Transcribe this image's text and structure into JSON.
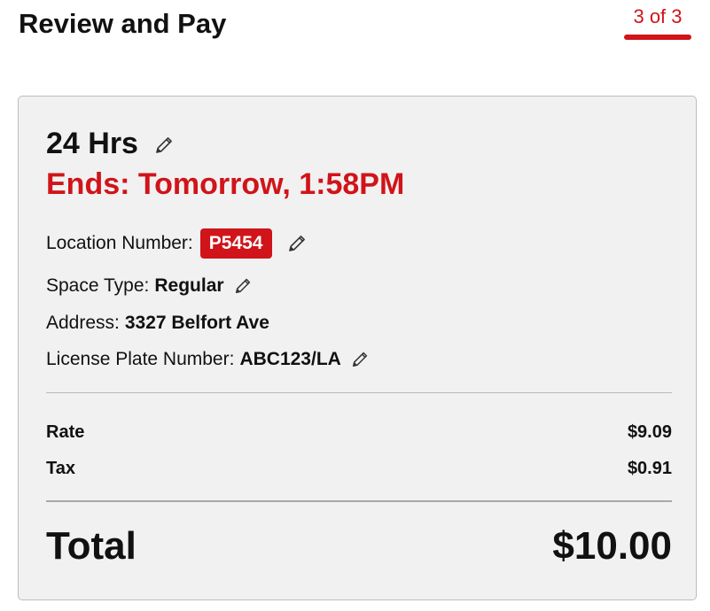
{
  "header": {
    "title": "Review and Pay",
    "step": "3 of 3"
  },
  "colors": {
    "accent": "#d0141a",
    "card_bg": "#f1f1f1"
  },
  "summary": {
    "duration": "24 Hrs",
    "ends": "Ends: Tomorrow, 1:58PM",
    "location_label": "Location Number:",
    "location_value": "P5454",
    "space_label": "Space Type:",
    "space_value": "Regular",
    "address_label": "Address:",
    "address_value": "3327 Belfort Ave",
    "plate_label": "License Plate Number:",
    "plate_value": "ABC123/LA"
  },
  "charges": {
    "rate_label": "Rate",
    "rate_value": "$9.09",
    "tax_label": "Tax",
    "tax_value": "$0.91",
    "total_label": "Total",
    "total_value": "$10.00"
  },
  "icons": {
    "edit": "pencil-icon"
  }
}
